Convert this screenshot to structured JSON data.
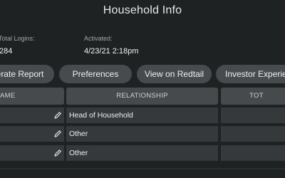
{
  "header": {
    "title": "Household Info"
  },
  "stats": {
    "total_logins_label": "Total Logins:",
    "total_logins_value": "284",
    "activated_label": "Activated:",
    "activated_value": "4/23/21 2:18pm"
  },
  "actions": {
    "generate_report": "erate Report",
    "preferences": "Preferences",
    "view_on_redtail": "View on Redtail",
    "investor_experience": "Investor Experie"
  },
  "table": {
    "columns": [
      "AME",
      "RELATIONSHIP",
      "TOT"
    ],
    "rows": [
      {
        "name": "",
        "relationship": "Head of Household",
        "total": ""
      },
      {
        "name": "",
        "relationship": "Other",
        "total": ""
      },
      {
        "name": "",
        "relationship": "Other",
        "total": ""
      }
    ]
  },
  "icons": {
    "edit": "pencil-icon"
  },
  "colors": {
    "background": "#1f2223",
    "button": "#474b4e",
    "header_cell": "#474a4d",
    "row_cell": "#36393b"
  }
}
